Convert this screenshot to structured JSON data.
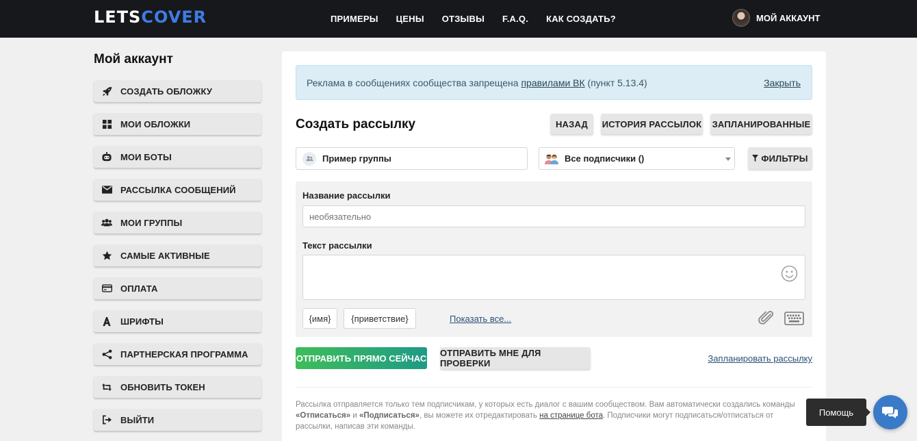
{
  "header": {
    "logo_part1": "LETS",
    "logo_part2": "COVER",
    "nav": [
      "ПРИМЕРЫ",
      "ЦЕНЫ",
      "ОТЗЫВЫ",
      "F.A.Q.",
      "КАК СОЗДАТЬ?"
    ],
    "account_label": "МОЙ АККАУНТ"
  },
  "sidebar": {
    "title": "Мой аккаунт",
    "items": [
      {
        "label": "СОЗДАТЬ ОБЛОЖКУ",
        "icon": "rocket-icon"
      },
      {
        "label": "МОИ ОБЛОЖКИ",
        "icon": "grid-icon"
      },
      {
        "label": "МОИ БОТЫ",
        "icon": "robot-icon"
      },
      {
        "label": "РАССЫЛКА СООБЩЕНИЙ",
        "icon": "envelope-icon"
      },
      {
        "label": "МОИ ГРУППЫ",
        "icon": "users-icon"
      },
      {
        "label": "САМЫЕ АКТИВНЫЕ",
        "icon": "star-icon"
      },
      {
        "label": "ОПЛАТА",
        "icon": "credit-card-icon"
      },
      {
        "label": "ШРИФТЫ",
        "icon": "font-icon"
      },
      {
        "label": "ПАРТНЕРСКАЯ ПРОГРАММА",
        "icon": "share-icon"
      },
      {
        "label": "ОБНОВИТЬ ТОКЕН",
        "icon": "retweet-icon"
      },
      {
        "label": "ВЫЙТИ",
        "icon": "sign-out-icon"
      }
    ]
  },
  "alert": {
    "text_before": "Реклама в сообщениях сообщества запрещена ",
    "link": "правилами ВК",
    "text_after": " (пункт 5.13.4)",
    "close": "Закрыть"
  },
  "main": {
    "title": "Создать рассылку",
    "back": "НАЗАД",
    "history": "ИСТОРИЯ РАССЫЛОК",
    "scheduled": "ЗАПЛАНИРОВАННЫЕ",
    "group_select": "Пример группы",
    "subscribers_select": "Все подписчики ()",
    "filters": "ФИЛЬТРЫ"
  },
  "form": {
    "name_label": "Название рассылки",
    "name_placeholder": "необязательно",
    "text_label": "Текст рассылки",
    "tag_name": "{имя}",
    "tag_greeting": "{приветствие}",
    "show_all": "Показать все..."
  },
  "actions": {
    "send_now": "ОТПРАВИТЬ ПРЯМО СЕЙЧАС",
    "send_test": "ОТПРАВИТЬ МНЕ ДЛЯ ПРОВЕРКИ",
    "schedule": "Запланировать рассылку"
  },
  "note": {
    "p1": "Рассылка отправляется только тем подписчикам, у которых есть диалог с вашим сообществом. Вам автоматически создались команды ",
    "cmd1": "«Отписаться»",
    "and": " и ",
    "cmd2": "«Подписаться»",
    "p2": ", вы можете их отредактировать ",
    "link": "на странице бота",
    "p3": ". Подписчики могут подписаться/отписаться от рассылки, написав эти команды."
  },
  "help": {
    "label": "Помощь"
  },
  "colors": {
    "header_bg": "#16181b",
    "logo_accent": "#3f7be6",
    "alert_bg": "#dcedf6",
    "send_gradient_start": "#3fbd5a",
    "send_gradient_end": "#1f9a86",
    "help_button": "#3a7bc8"
  }
}
